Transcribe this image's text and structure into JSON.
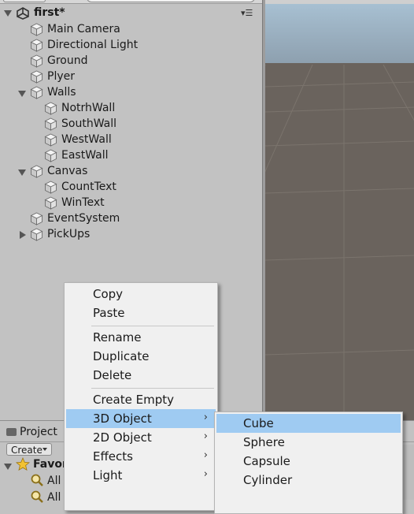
{
  "hierarchy": {
    "scene_name": "first*",
    "items": [
      {
        "label": "Main Camera",
        "depth": 0,
        "fold": "none"
      },
      {
        "label": "Directional Light",
        "depth": 0,
        "fold": "none"
      },
      {
        "label": "Ground",
        "depth": 0,
        "fold": "none"
      },
      {
        "label": "Plyer",
        "depth": 0,
        "fold": "none"
      },
      {
        "label": "Walls",
        "depth": 0,
        "fold": "open"
      },
      {
        "label": "NotrhWall",
        "depth": 1,
        "fold": "none"
      },
      {
        "label": "SouthWall",
        "depth": 1,
        "fold": "none"
      },
      {
        "label": "WestWall",
        "depth": 1,
        "fold": "none"
      },
      {
        "label": "EastWall",
        "depth": 1,
        "fold": "none"
      },
      {
        "label": "Canvas",
        "depth": 0,
        "fold": "open"
      },
      {
        "label": "CountText",
        "depth": 1,
        "fold": "none"
      },
      {
        "label": "WinText",
        "depth": 1,
        "fold": "none"
      },
      {
        "label": "EventSystem",
        "depth": 0,
        "fold": "none"
      },
      {
        "label": "PickUps",
        "depth": 0,
        "fold": "closed"
      }
    ]
  },
  "project": {
    "tab_label": "Project",
    "create_label": "Create",
    "favorites_label": "Favor",
    "fav_all_label": "All",
    "fav_all2_label": "All"
  },
  "context_menu": {
    "items": [
      {
        "label": "Copy",
        "submenu": false
      },
      {
        "label": "Paste",
        "submenu": false
      },
      {
        "sep": true
      },
      {
        "label": "Rename",
        "submenu": false
      },
      {
        "label": "Duplicate",
        "submenu": false
      },
      {
        "label": "Delete",
        "submenu": false
      },
      {
        "sep": true
      },
      {
        "label": "Create Empty",
        "submenu": false
      },
      {
        "label": "3D Object",
        "submenu": true,
        "highlighted": true
      },
      {
        "label": "2D Object",
        "submenu": true
      },
      {
        "label": "Effects",
        "submenu": true
      },
      {
        "label": "Light",
        "submenu": true
      }
    ]
  },
  "submenu_3d": {
    "items": [
      {
        "label": "Cube",
        "highlighted": true
      },
      {
        "label": "Sphere"
      },
      {
        "label": "Capsule"
      },
      {
        "label": "Cylinder"
      }
    ]
  },
  "colors": {
    "panel_bg": "#c2c2c2",
    "menu_bg": "#f0f0f0",
    "menu_highlight": "#9fcbf2",
    "scene_sky": "#9fb6c8",
    "scene_ground": "#6a635d"
  },
  "icons": {
    "scene": "unity-logo-icon",
    "game_object": "cube-icon",
    "favorites": "star-icon",
    "search_filter": "magnifier-icon",
    "submenu": "chevron-right-icon"
  }
}
